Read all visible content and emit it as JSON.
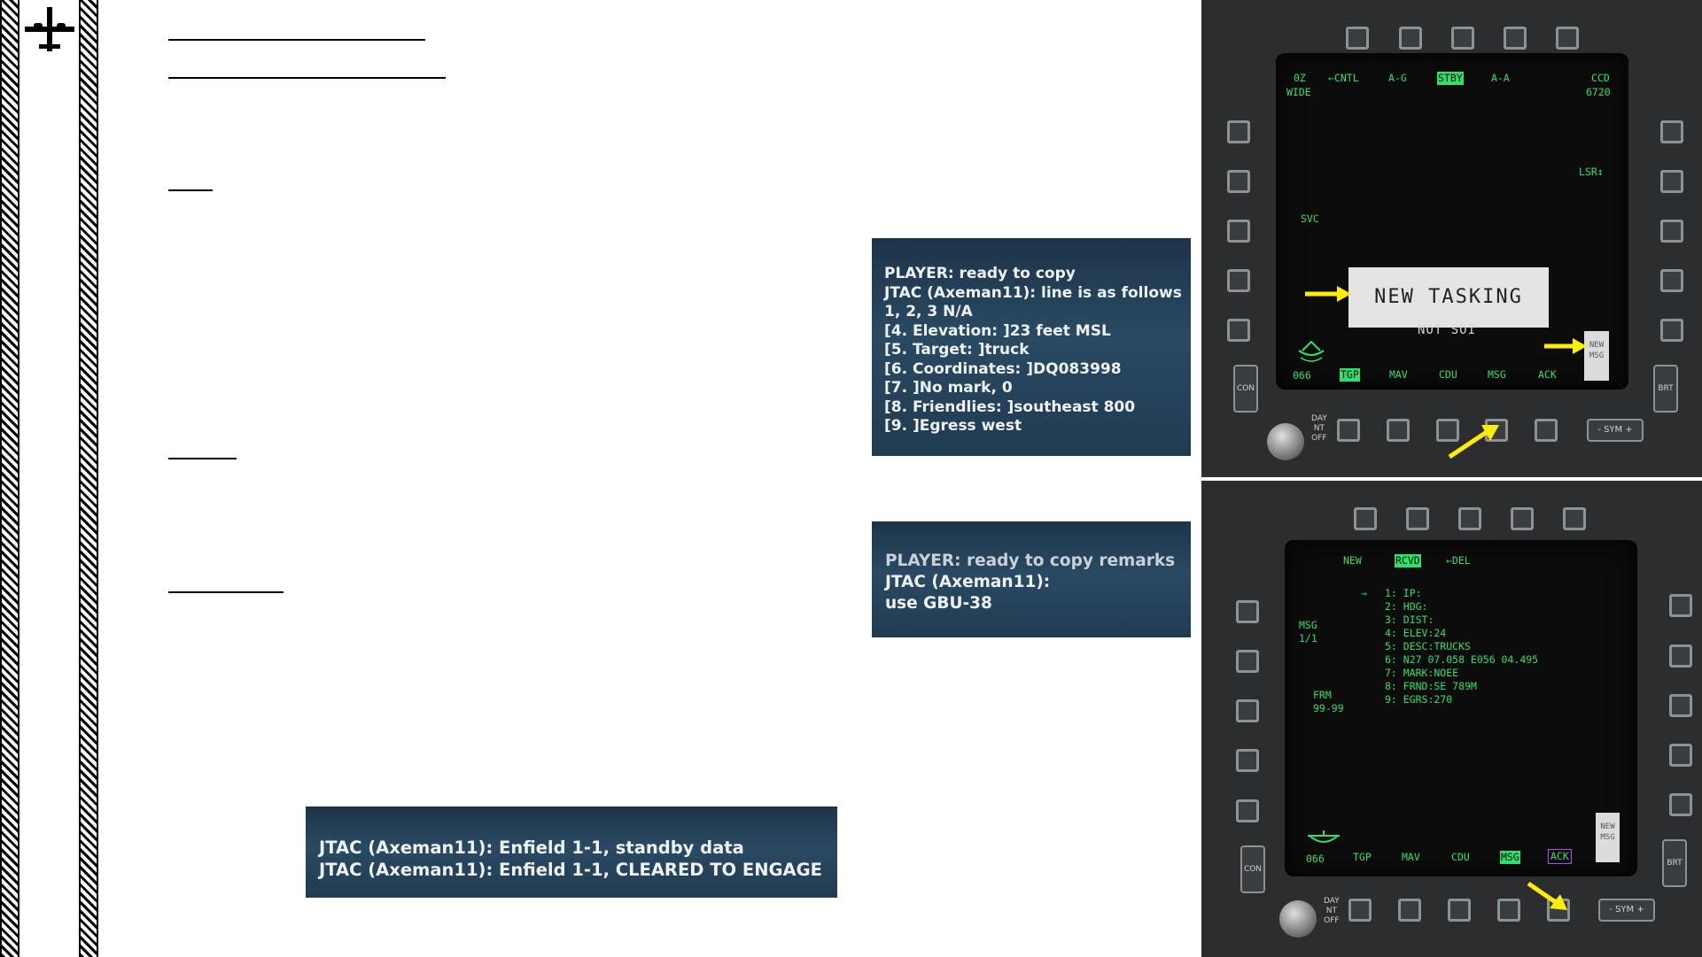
{
  "chat_box_1": {
    "lines": [
      "PLAYER: ready to copy",
      "JTAC (Axeman11): line is as follows",
      "1, 2, 3 N/A",
      "[4. Elevation: ]23 feet MSL",
      "[5. Target: ]truck",
      "[6. Coordinates: ]DQ083998",
      "[7. ]No mark, 0",
      "[8. Friendlies: ]southeast 800",
      "[9. ]Egress west"
    ]
  },
  "chat_box_2": {
    "lines": [
      "PLAYER: ready to copy remarks",
      "JTAC (Axeman11):",
      "use GBU-38"
    ]
  },
  "chat_box_3": {
    "lines": [
      "JTAC (Axeman11): Enfield 1-1, standby data",
      "JTAC (Axeman11): Enfield 1-1, CLEARED TO ENGAGE"
    ]
  },
  "mfd_top": {
    "zoom": "0Z",
    "zoom_mode": "WIDE",
    "cntl": "←CNTL",
    "ag": "A-G",
    "stby": "STBY",
    "aa": "A-A",
    "ccd": "CCD",
    "ccd_value": "6720",
    "lsr": "LSR↕",
    "svc": "SVC",
    "tasking_title": "NEW TASKING",
    "not_soi": "NOT SOI",
    "new_msg": [
      "NEW",
      "MSG"
    ],
    "heading": "066",
    "bottom_labels": [
      "TGP",
      "MAV",
      "CDU",
      "MSG",
      "ACK"
    ],
    "con": "CON",
    "brt": "BRT",
    "sym": "- SYM +",
    "day_nt_off": [
      "DAY",
      "NT",
      "OFF"
    ]
  },
  "mfd_bottom": {
    "new": "NEW",
    "rcvd": "RCVD",
    "del": "←DEL",
    "msg_label": [
      "MSG",
      "1/1"
    ],
    "frm_label": [
      "FRM",
      "99-99"
    ],
    "pointer": "→",
    "lines": [
      "1: IP:",
      "2: HDG:",
      "3: DIST:",
      "4: ELEV:24",
      "5: DESC:TRUCKS",
      "6: N27 07.058 E056 04.495",
      "7: MARK:NOEE",
      "8: FRND:SE 789M",
      "9: EGRS:270"
    ],
    "new_msg": [
      "NEW",
      "MSG"
    ],
    "heading": "066",
    "bottom_labels": [
      "TGP",
      "MAV",
      "CDU",
      "MSG",
      "ACK"
    ],
    "con": "CON",
    "brt": "BRT",
    "sym": "- SYM +",
    "day_nt_off": [
      "DAY",
      "NT",
      "OFF"
    ]
  },
  "colors": {
    "mfd_green": "#2fe06a",
    "arrow_yellow": "#ffee00",
    "chat_bg": "#203b51",
    "ack_box": "#c040ff"
  }
}
